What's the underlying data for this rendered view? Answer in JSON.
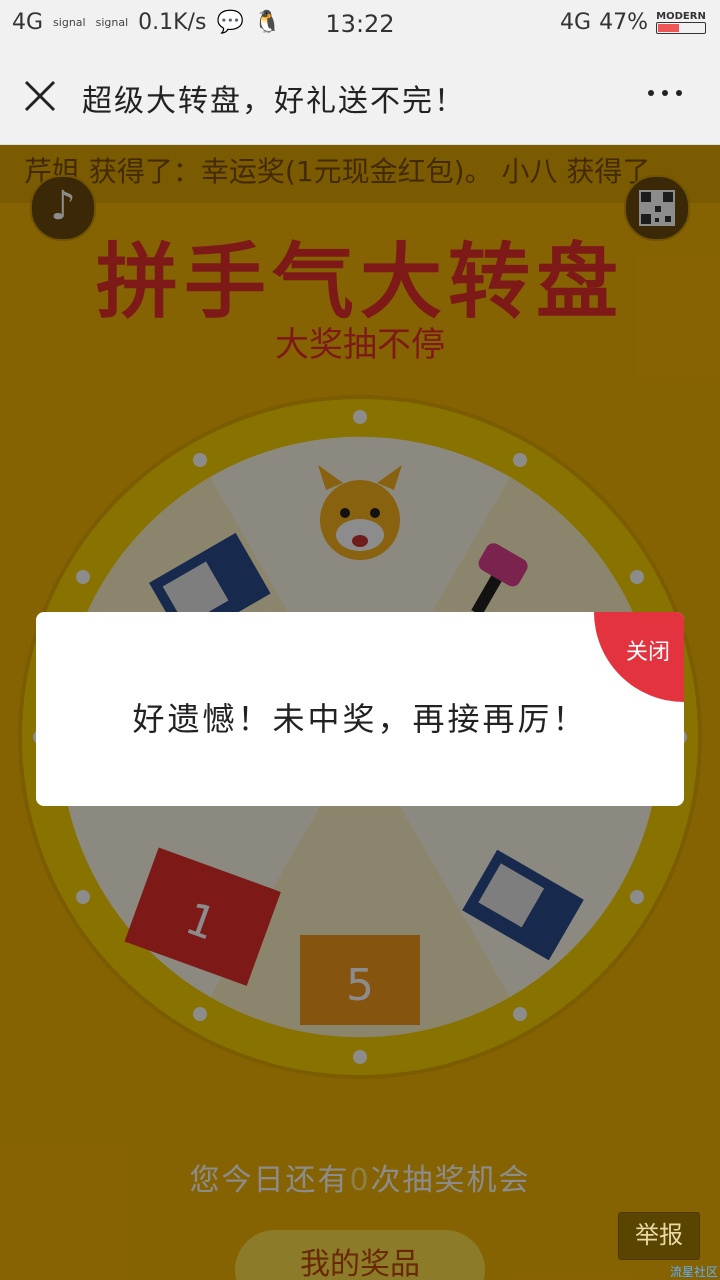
{
  "status": {
    "network_left": "4G",
    "signal1": "signal",
    "signal2": "signal",
    "speed": "0.1K/s",
    "time": "13:22",
    "network_right": "4G",
    "battery_percent": "47%",
    "battery_brand": "MODERN",
    "battery_level": 0.47
  },
  "titlebar": {
    "title": "超级大转盘，好礼送不完！"
  },
  "page": {
    "ticker": "芹姐 获得了：幸运奖(1元现金红包)。 小八 获得了",
    "headline": "拼手气大转盘",
    "subline": "大奖抽不停",
    "chances_prefix": "您今日还有",
    "chances_count": "0",
    "chances_suffix": "次抽奖机会",
    "prizes_button": "我的奖品"
  },
  "dialog": {
    "message": "好遗憾！未中奖，再接再厉！",
    "close_label": "关闭"
  },
  "report_label": "举报",
  "watermark": "流星社区",
  "colors": {
    "accent": "#e3333f",
    "page_bg": "#f5b505",
    "headline": "#e3312c"
  }
}
